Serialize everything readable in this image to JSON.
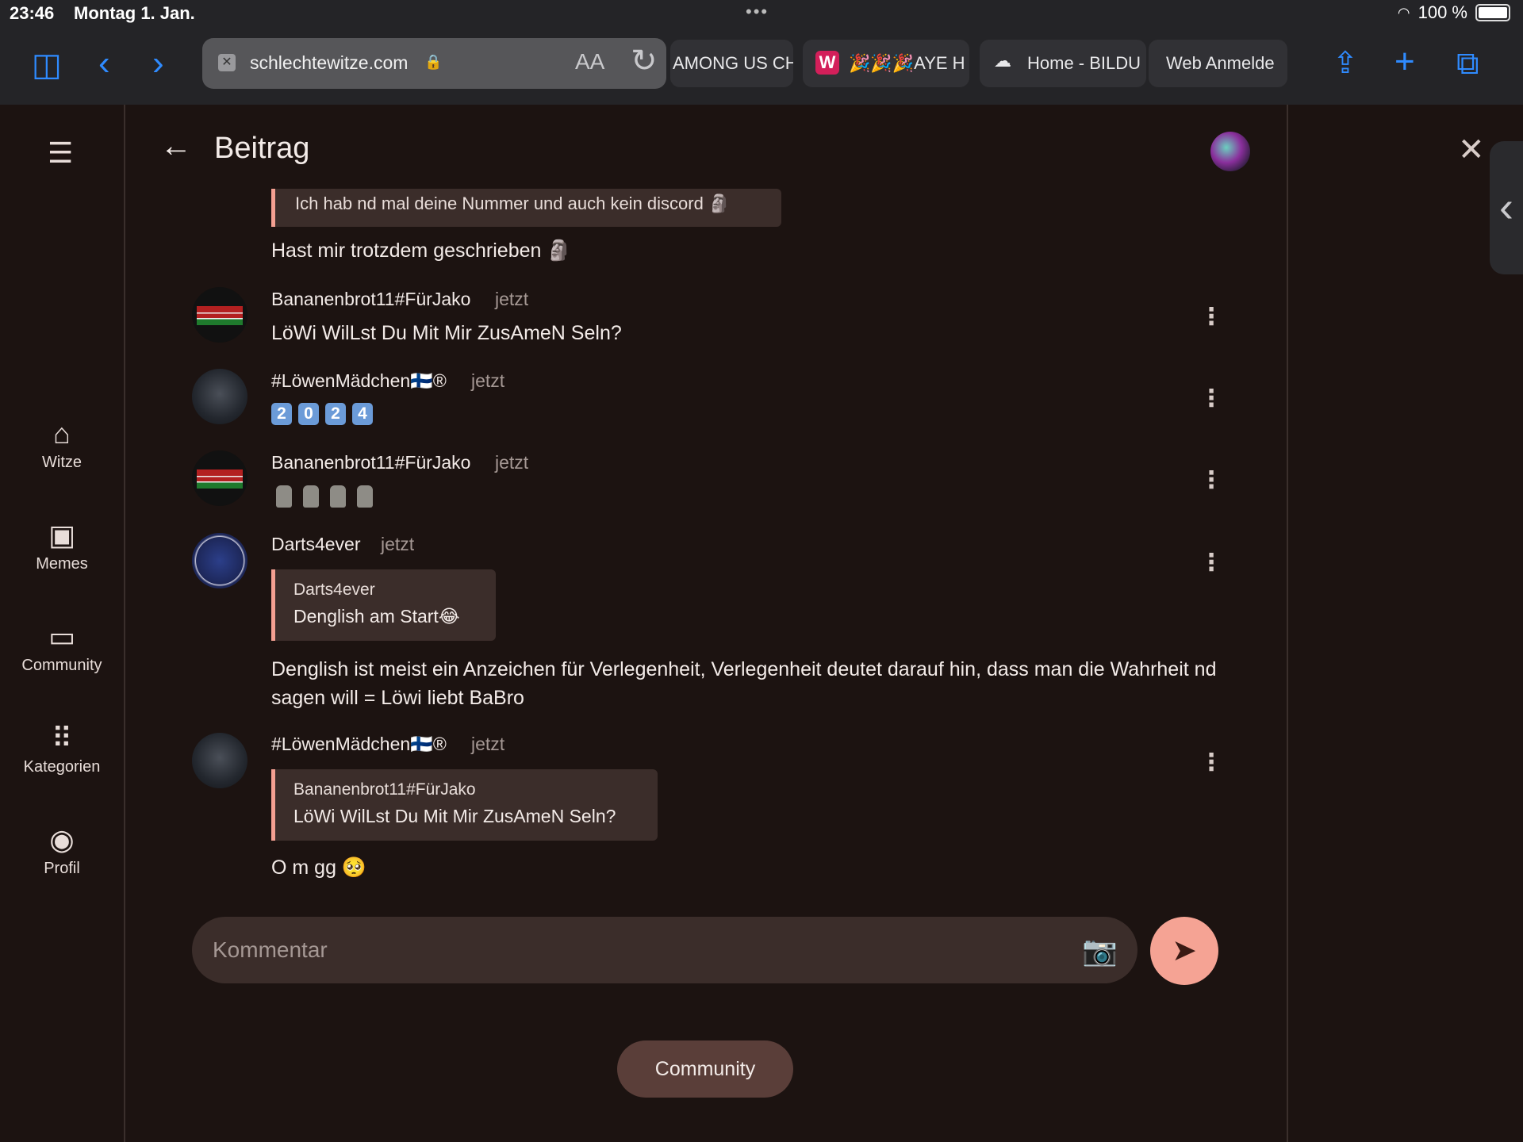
{
  "status": {
    "time": "23:46",
    "date": "Montag 1. Jan.",
    "battery": "100 %"
  },
  "browser": {
    "url": "schlechtewitze.com",
    "text_size_label": "AA",
    "tabs": [
      "AMONG US CH",
      "🎉🎉🎉AYE H",
      "Home - BILDU",
      "Web Anmelde"
    ]
  },
  "sidebar": {
    "items": [
      {
        "label": "Witze",
        "icon": "home-icon"
      },
      {
        "label": "Memes",
        "icon": "image-icon"
      },
      {
        "label": "Community",
        "icon": "chat-icon"
      },
      {
        "label": "Kategorien",
        "icon": "grid-icon"
      },
      {
        "label": "Profil",
        "icon": "profile-icon"
      }
    ]
  },
  "header": {
    "title": "Beitrag"
  },
  "thread": {
    "top_quote_text": "Ich hab nd mal deine Nummer und auch kein discord 🗿",
    "top_message_text": "Hast mir trotzdem geschrieben 🗿",
    "messages": [
      {
        "user": "Bananenbrot11#FürJako",
        "time": "jetzt",
        "text": "LöWi WilLst Du Mit Mir ZusAmeN Seln?"
      },
      {
        "user": "#LöwenMädchen🇫🇮®",
        "time": "jetzt",
        "text": "2 0 2 4",
        "digits": [
          "2",
          "0",
          "2",
          "4"
        ]
      },
      {
        "user": "Bananenbrot11#FürJako",
        "time": "jetzt",
        "text": "🗿🗿🗿🗿"
      },
      {
        "user": "Darts4ever",
        "time": "jetzt",
        "quote": {
          "user": "Darts4ever",
          "text": "Denglish am Start😂"
        },
        "text": "Denglish ist meist ein Anzeichen für Verlegenheit, Verlegenheit deutet darauf hin, dass man die Wahrheit nd sagen will = Löwi liebt BaBro"
      },
      {
        "user": "#LöwenMädchen🇫🇮®",
        "time": "jetzt",
        "quote": {
          "user": "Bananenbrot11#FürJako",
          "text": "LöWi WilLst Du Mit Mir ZusAmeN Seln?"
        },
        "text": "O m gg 🥺"
      }
    ]
  },
  "comment": {
    "placeholder": "Kommentar"
  },
  "community_button": "Community",
  "colors": {
    "background": "#1c1311",
    "accent": "#f5a394",
    "quote_bg": "#3b2d2a"
  }
}
